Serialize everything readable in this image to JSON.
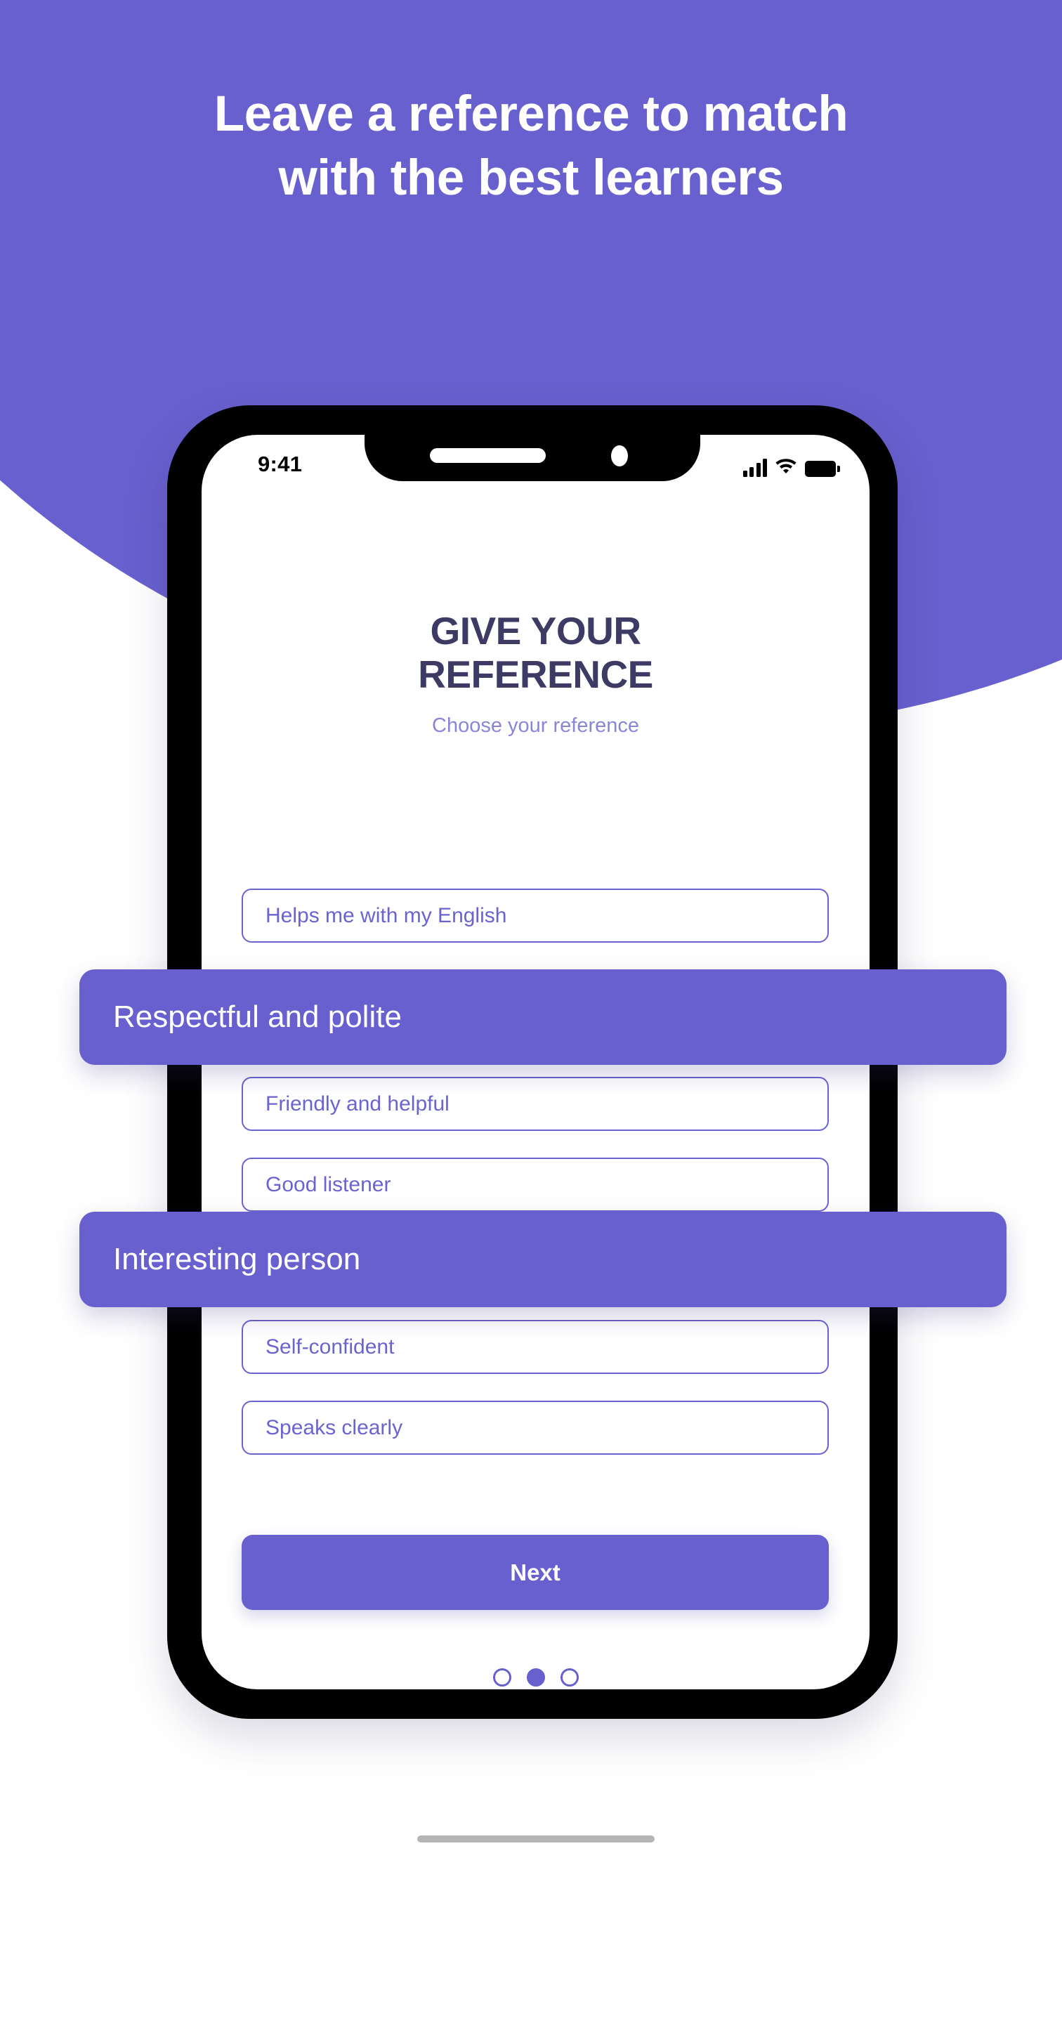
{
  "promo": {
    "headline_line1": "Leave a reference to match",
    "headline_line2": "with the best learners"
  },
  "colors": {
    "brand_purple": "#6860CE",
    "heading_navy": "#3D3A63",
    "subtitle_purple": "#8B85D8",
    "pill_border": "#6B63CF",
    "phone_bezel": "#000000",
    "home_indicator": "#B5B5B5"
  },
  "phone": {
    "status_bar": {
      "time": "9:41",
      "icons": [
        "cellular-signal-icon",
        "wifi-icon",
        "battery-icon"
      ]
    },
    "home_indicator": "home-indicator-bar"
  },
  "screen": {
    "title_line1": "GIVE YOUR",
    "title_line2": "REFERENCE",
    "subtitle": "Choose your reference",
    "options": [
      {
        "label": "Helps me with my English",
        "selected": false
      },
      {
        "label": "Respectful and polite",
        "selected": true
      },
      {
        "label": "Friendly and helpful",
        "selected": false
      },
      {
        "label": "Good listener",
        "selected": false
      },
      {
        "label": "Interesting person",
        "selected": true
      },
      {
        "label": "Self-confident",
        "selected": false
      },
      {
        "label": "Speaks clearly",
        "selected": false
      }
    ],
    "next_button": "Next",
    "pagination": {
      "total": 3,
      "active_index": 2
    }
  }
}
